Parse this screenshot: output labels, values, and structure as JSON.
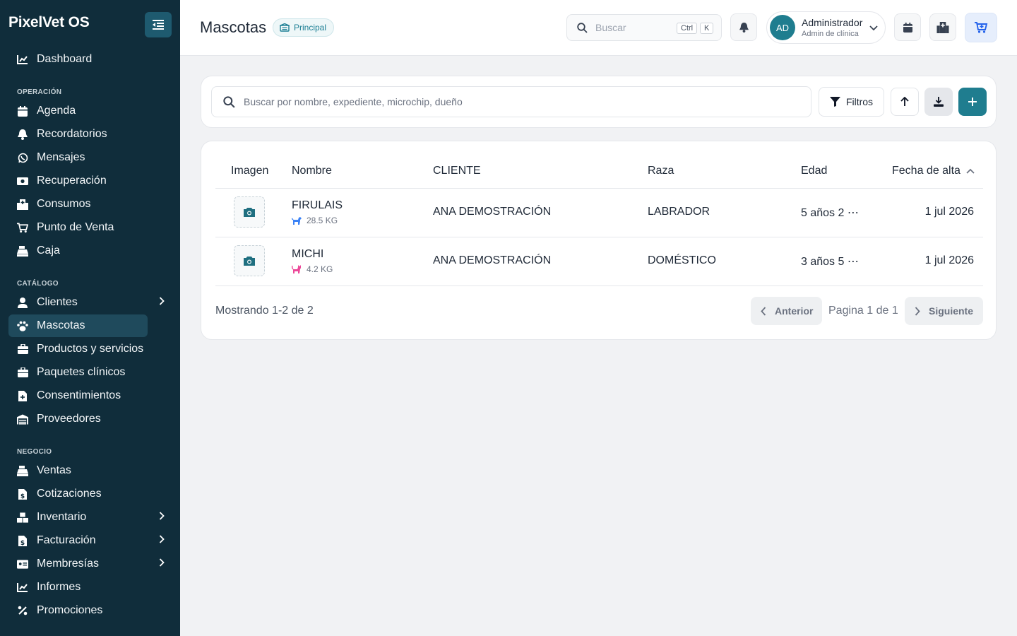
{
  "app": {
    "brand": "PixelVet OS"
  },
  "sidebar": {
    "top_item": {
      "label": "Dashboard",
      "icon": "chart-line-icon"
    },
    "sections": [
      {
        "title": "OPERACIÓN",
        "items": [
          {
            "label": "Agenda",
            "icon": "calendar-icon"
          },
          {
            "label": "Recordatorios",
            "icon": "bell-icon"
          },
          {
            "label": "Mensajes",
            "icon": "whatsapp-icon"
          },
          {
            "label": "Recuperación",
            "icon": "money-bill-icon"
          },
          {
            "label": "Consumos",
            "icon": "hospital-icon"
          },
          {
            "label": "Punto de Venta",
            "icon": "cart-icon"
          },
          {
            "label": "Caja",
            "icon": "cash-register-icon"
          }
        ]
      },
      {
        "title": "CATÁLOGO",
        "items": [
          {
            "label": "Clientes",
            "icon": "user-icon",
            "expandable": true
          },
          {
            "label": "Mascotas",
            "icon": "paw-icon",
            "active": true
          },
          {
            "label": "Productos y servicios",
            "icon": "briefcase-icon"
          },
          {
            "label": "Paquetes clínicos",
            "icon": "briefcase-medical-icon"
          },
          {
            "label": "Consentimientos",
            "icon": "file-medical-icon"
          },
          {
            "label": "Proveedores",
            "icon": "warehouse-icon"
          }
        ]
      },
      {
        "title": "NEGOCIO",
        "items": [
          {
            "label": "Ventas",
            "icon": "cash-register-icon"
          },
          {
            "label": "Cotizaciones",
            "icon": "file-invoice-dollar-icon"
          },
          {
            "label": "Inventario",
            "icon": "boxes-icon",
            "expandable": true
          },
          {
            "label": "Facturación",
            "icon": "file-invoice-icon",
            "expandable": true
          },
          {
            "label": "Membresías",
            "icon": "id-card-icon",
            "expandable": true
          },
          {
            "label": "Informes",
            "icon": "chart-line-icon"
          },
          {
            "label": "Promociones",
            "icon": "percent-icon"
          }
        ]
      }
    ]
  },
  "header": {
    "title": "Mascotas",
    "branch_badge": "Principal",
    "search_placeholder": "Buscar",
    "shortcut_keys": [
      "Ctrl",
      "K"
    ],
    "user": {
      "initials": "AD",
      "name": "Administrador",
      "role": "Admin de clínica"
    }
  },
  "toolbar": {
    "search_placeholder": "Buscar por nombre, expediente, microchip, dueño",
    "filters_label": "Filtros"
  },
  "table": {
    "columns": [
      "Imagen",
      "Nombre",
      "CLIENTE",
      "Raza",
      "Edad",
      "Fecha de alta"
    ],
    "sort": {
      "column": "Fecha de alta",
      "direction": "asc"
    },
    "rows": [
      {
        "name": "FIRULAIS",
        "weight": "28.5 KG",
        "species_icon": "dog-icon",
        "client": "ANA DEMOSTRACIÓN",
        "breed": "LABRADOR",
        "age": "5 años 2 ⋯",
        "date": "1 jul 2026"
      },
      {
        "name": "MICHI",
        "weight": "4.2 KG",
        "species_icon": "cat-icon",
        "client": "ANA DEMOSTRACIÓN",
        "breed": "DOMÉSTICO",
        "age": "3 años 5 ⋯",
        "date": "1 jul 2026"
      }
    ]
  },
  "pagination": {
    "summary": "Mostrando 1-2 de 2",
    "prev_label": "Anterior",
    "page_label": "Pagina 1 de 1",
    "next_label": "Siguiente"
  },
  "colors": {
    "sidebar": "#102d3b",
    "accent": "#1f7d8f",
    "dog": "#3b82f6",
    "cat": "#ec4899"
  }
}
